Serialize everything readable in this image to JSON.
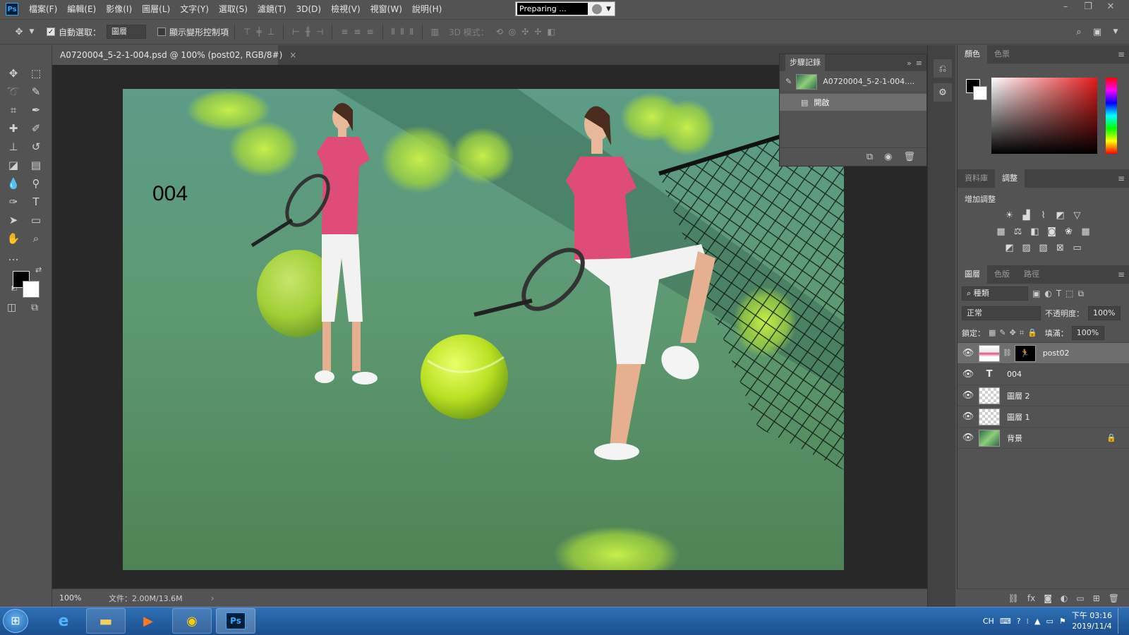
{
  "app": {
    "logo": "Ps"
  },
  "menu": [
    "檔案(F)",
    "編輯(E)",
    "影像(I)",
    "圖層(L)",
    "文字(Y)",
    "選取(S)",
    "濾鏡(T)",
    "3D(D)",
    "檢視(V)",
    "視窗(W)",
    "說明(H)"
  ],
  "status_popup": {
    "text": "Preparing ..."
  },
  "options": {
    "auto_select_label": "自動選取：",
    "auto_select_value": "圖層",
    "show_transform_label": "顯示變形控制項",
    "mode_3d_label": "3D 模式："
  },
  "document": {
    "tab_title": "A0720004_5-2-1-004.psd @ 100% (post02, RGB/8#)",
    "close": "×",
    "canvas_text": "004"
  },
  "status": {
    "zoom": "100%",
    "docsize": "文件：2.00M/13.6M",
    "arrow": "›"
  },
  "history": {
    "tab": "步驟記錄",
    "snapshot": "A0720004_5-2-1-004....",
    "step": "開啟"
  },
  "color_panel": {
    "tabs": [
      "顏色",
      "色票"
    ],
    "fg": "#000000",
    "bg": "#ffffff",
    "hue": "#e31b1b"
  },
  "adjust_panel": {
    "tabs": [
      "資料庫",
      "調整"
    ],
    "title": "增加調整"
  },
  "layers_panel": {
    "tabs": [
      "圖層",
      "色版",
      "路徑"
    ],
    "filter": "種類",
    "blend": "正常",
    "opacity_label": "不透明度：",
    "opacity": "100%",
    "lock_label": "鎖定：",
    "fill_label": "填滿：",
    "fill": "100%",
    "layers": [
      {
        "name": "post02",
        "type": "masked"
      },
      {
        "name": "004",
        "type": "text"
      },
      {
        "name": "圖層 2",
        "type": "pixel"
      },
      {
        "name": "圖層 1",
        "type": "pixel"
      },
      {
        "name": "背景",
        "type": "background"
      }
    ]
  },
  "taskbar": {
    "ime": "CH",
    "time": "下午 03:16",
    "date": "2019/11/4"
  }
}
